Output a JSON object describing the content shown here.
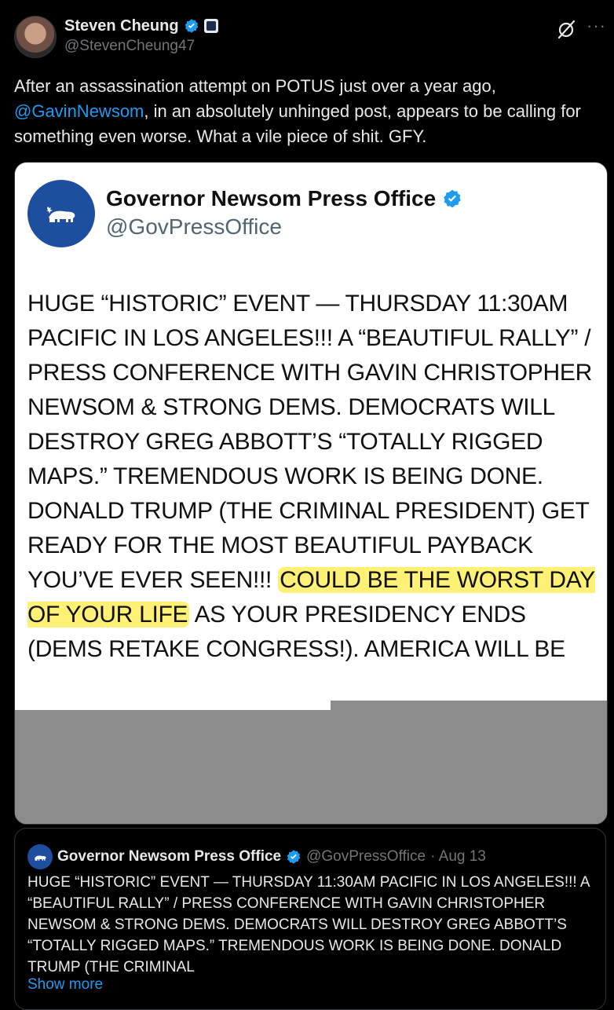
{
  "author": {
    "name": "Steven Cheung",
    "handle": "@StevenCheung47"
  },
  "tweet": {
    "text_before": "After an assassination attempt on POTUS just over a year ago, ",
    "mention": "@GavinNewsom",
    "text_after": ", in an absolutely unhinged post, appears to be calling for something even worse. What a vile piece of shit. GFY."
  },
  "media": {
    "name": "Governor Newsom Press Office",
    "handle": "@GovPressOffice",
    "body_1": "HUGE “HISTORIC” EVENT — THURSDAY 11:30AM PACIFIC IN LOS ANGELES!!!  A “BEAUTIFUL RALLY” / PRESS CONFERENCE WITH GAVIN CHRISTOPHER NEWSOM & STRONG DEMS. DEMOCRATS WILL DESTROY GREG ABBOTT’S “TOTALLY RIGGED MAPS.” TREMENDOUS WORK IS BEING DONE.  DONALD TRUMP (THE CRIMINAL PRESIDENT) GET READY FOR THE MOST BEAUTIFUL PAYBACK YOU’VE EVER SEEN!!! ",
    "body_highlight": "COULD BE THE WORST DAY OF YOUR LIFE",
    "body_2": " AS YOUR PRESIDENCY ENDS (DEMS RETAKE CONGRESS!). AMERICA WILL BE"
  },
  "quote": {
    "name": "Governor Newsom Press Office",
    "handle": "@GovPressOffice",
    "date": "· Aug 13",
    "body": "HUGE “HISTORIC” EVENT — THURSDAY 11:30AM PACIFIC IN LOS ANGELES!!!  A “BEAUTIFUL RALLY” / PRESS CONFERENCE WITH GAVIN CHRISTOPHER NEWSOM & STRONG DEMS. DEMOCRATS WILL DESTROY GREG ABBOTT’S “TOTALLY RIGGED MAPS.” TREMENDOUS WORK IS BEING DONE.  DONALD TRUMP (THE CRIMINAL",
    "show_more": "Show more"
  },
  "colors": {
    "background": "#000000",
    "accent": "#1d9bf0",
    "highlight": "#fff176",
    "seal_blue": "#1e4f9e"
  },
  "icons": [
    "verified-badge-icon",
    "affiliate-badge-icon",
    "grok-icon",
    "more-options-icon",
    "bear-seal-icon"
  ]
}
